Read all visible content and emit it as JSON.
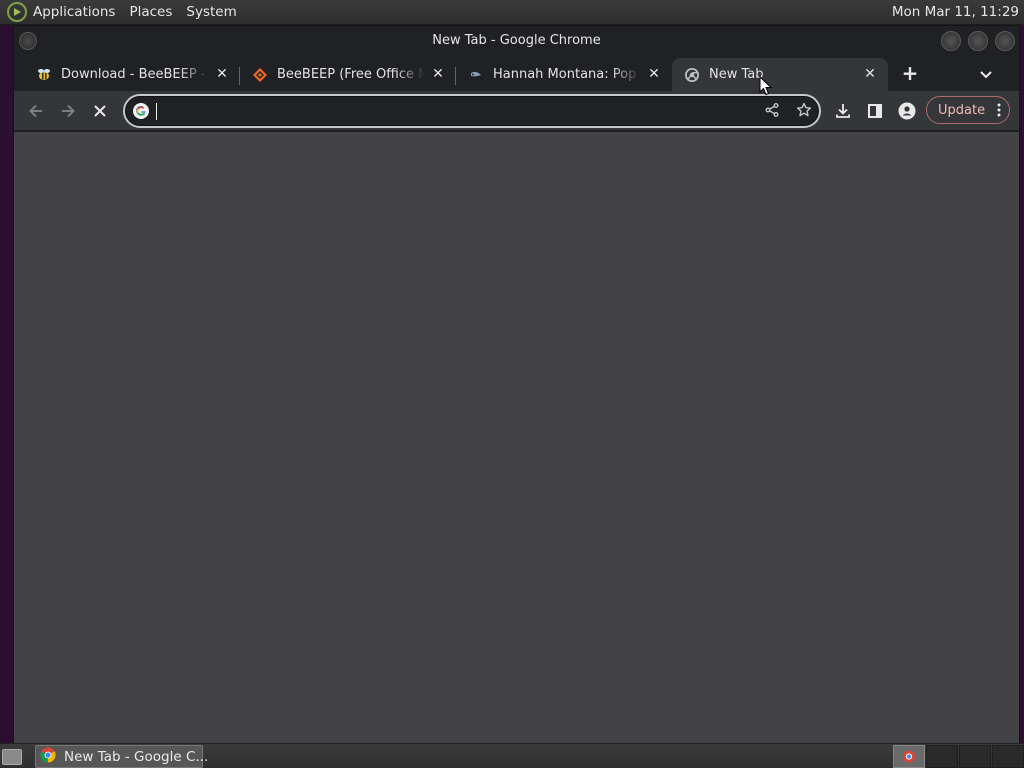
{
  "top_panel": {
    "menus": [
      "Applications",
      "Places",
      "System"
    ],
    "clock": "Mon Mar 11, 11:29"
  },
  "window": {
    "title": "New Tab - Google Chrome"
  },
  "tabs": [
    {
      "title": "Download - BeeBEEP - Free Office Messenger",
      "favicon": "bee-icon",
      "active": false
    },
    {
      "title": "BeeBEEP (Free Office Messenger)",
      "favicon": "sourceforge-icon",
      "active": false
    },
    {
      "title": "Hannah Montana: Pop Star",
      "favicon": "site-icon",
      "active": false
    },
    {
      "title": "New Tab",
      "favicon": "chrome-icon",
      "active": true
    }
  ],
  "toolbar": {
    "address_value": "",
    "update_label": "Update"
  },
  "taskbar": {
    "task_label": "New Tab - Google C..."
  },
  "colors": {
    "accent_update": "#f0b9b4",
    "content_bg": "#434347",
    "toolbar_bg": "#35363a"
  }
}
